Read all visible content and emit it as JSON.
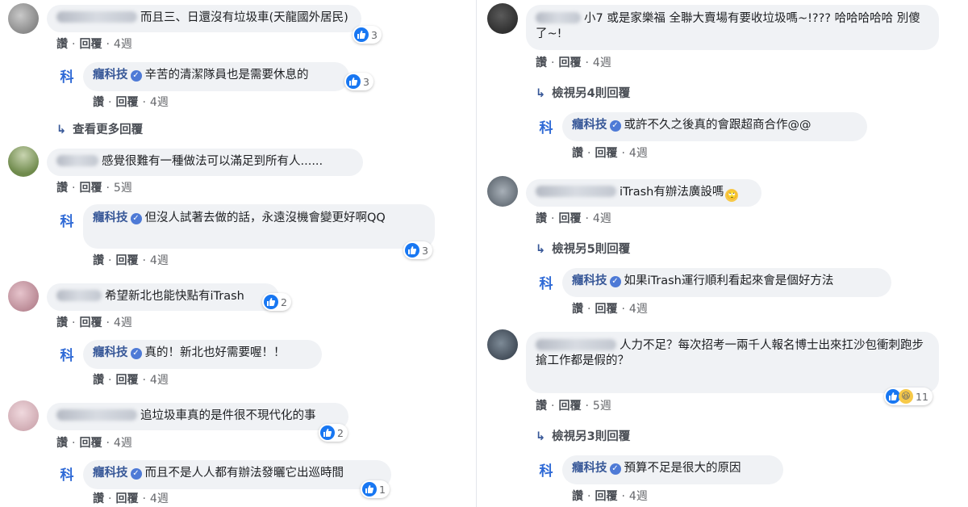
{
  "actions": {
    "like": "讚",
    "reply": "回覆",
    "sep": "·"
  },
  "page_name": "癮科技",
  "page_avatar_char": "科",
  "left": {
    "c1": {
      "text": "而且三、日還沒有垃圾車(天龍國外居民)",
      "time": "4週",
      "likes": "3"
    },
    "r1": {
      "text": "辛苦的清潔隊員也是需要休息的",
      "time": "4週",
      "likes": "3"
    },
    "more1": "查看更多回覆",
    "c2": {
      "text": "感覺很難有一種做法可以滿足到所有人......",
      "time": "5週"
    },
    "r2": {
      "text": "但沒人試著去做的話，永遠沒機會變更好啊QQ",
      "time": "4週",
      "likes": "3"
    },
    "c3": {
      "text": "希望新北也能快點有iTrash",
      "time": "4週",
      "likes": "2"
    },
    "r3": {
      "text": "真的！新北也好需要喔！！",
      "time": "4週"
    },
    "c4": {
      "text": "追垃圾車真的是件很不現代化的事",
      "time": "4週",
      "likes": "2"
    },
    "r4": {
      "text": "而且不是人人都有辦法發曬它出巡時間",
      "time": "4週",
      "likes": "1"
    }
  },
  "right": {
    "c1": {
      "text": "小7 或是家樂福 全聯大賣場有要收垃圾嗎~!??? 哈哈哈哈哈 別傻了~!",
      "time": "4週"
    },
    "more1": "檢視另4則回覆",
    "r1": {
      "text": "或許不久之後真的會跟超商合作@@",
      "time": "4週"
    },
    "c2": {
      "text": "iTrash有辦法廣設嗎",
      "emoji": "🙄",
      "time": "4週"
    },
    "more2": "檢視另5則回覆",
    "r2": {
      "text": "如果iTrash運行順利看起來會是個好方法",
      "time": "4週"
    },
    "c3": {
      "text": "人力不足？每次招考一兩千人報名博士出來扛沙包衝刺跑步搶工作都是假的？",
      "time": "5週",
      "likes": "11"
    },
    "more3": "檢視另3則回覆",
    "r3": {
      "text": "預算不足是很大的原因",
      "time": "4週"
    }
  },
  "colors": {
    "link": "#385898",
    "bubble": "#f0f2f5",
    "like_blue": "#1877f2",
    "page_avatar": "#2f6ad6"
  },
  "icons": [
    "like-icon",
    "haha-icon",
    "verified-badge-icon",
    "reply-arrow-icon"
  ]
}
